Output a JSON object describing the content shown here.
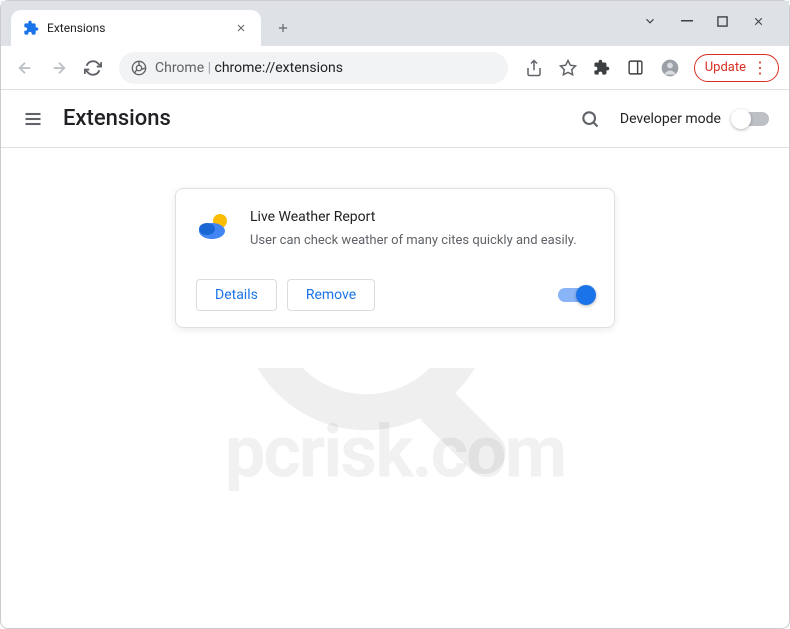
{
  "tab": {
    "title": "Extensions"
  },
  "omnibox": {
    "prefix": "Chrome",
    "url": "chrome://extensions"
  },
  "toolbar": {
    "update_label": "Update"
  },
  "page": {
    "title": "Extensions",
    "dev_mode_label": "Developer mode",
    "dev_mode_on": false
  },
  "extension": {
    "name": "Live Weather Report",
    "description": "User can check weather of many cites quickly and easily.",
    "details_label": "Details",
    "remove_label": "Remove",
    "enabled": true
  },
  "watermark": {
    "text": "pcrisk.com"
  }
}
